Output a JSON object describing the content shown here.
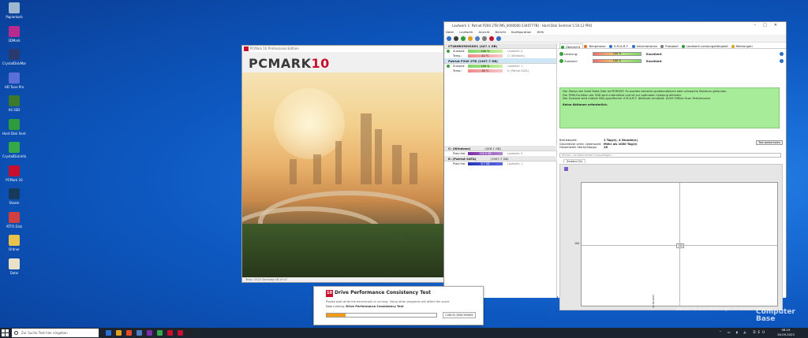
{
  "desktop": {
    "icons": [
      {
        "label": "Papierkorb",
        "color": "#9fb6cf"
      },
      {
        "label": "3DMark",
        "color": "#b82b8c"
      },
      {
        "label": "CrystalDiskMark",
        "color": "#2b3a6e"
      },
      {
        "label": "HD Tune Pro",
        "color": "#5a6fd8"
      },
      {
        "label": "AS SSD",
        "color": "#3a7a2a"
      },
      {
        "label": "Hard Disk Sentinel",
        "color": "#2d9c3c"
      },
      {
        "label": "CrystalDiskInfo",
        "color": "#35a84a"
      },
      {
        "label": "PCMark 10",
        "color": "#c8102e"
      },
      {
        "label": "Steam",
        "color": "#163a5c"
      },
      {
        "label": "ATTO Disk",
        "color": "#d33f3f"
      },
      {
        "label": "Ordner",
        "color": "#e8c24a"
      },
      {
        "label": "Datei",
        "color": "#e9e2c8"
      }
    ]
  },
  "pcmark": {
    "window_title": "PCMark 10 Professional Edition",
    "brand_main": "PCMARK",
    "brand_num": "10",
    "status": "Tests: 2025 Samstag 08:19:47"
  },
  "hds": {
    "window_title": "Laufwerk 1: Patriot P200 2TB [MS_0000000 2340777B] - Hard Disk Sentinel 5.50.12 PRO",
    "menu": [
      "Datei",
      "Laufwerk",
      "Ansicht",
      "Bericht",
      "Konfiguration",
      "Hilfe"
    ],
    "disks": [
      {
        "name": "CT480BX500SSD1 (447.1 GB)",
        "selected": false,
        "rows": [
          {
            "label": "Zustand:",
            "value": "100 %",
            "type": "health",
            "note": "Laufwerk: 0"
          },
          {
            "label": "Temp.:",
            "value": "42 °C",
            "type": "temp",
            "note": "C: [Windows]"
          }
        ]
      },
      {
        "name": "Patriot P200 2TB (1907.7 GB)",
        "selected": true,
        "rows": [
          {
            "label": "Zustand:",
            "value": "100 %",
            "type": "health",
            "note": "Laufwerk: 1"
          },
          {
            "label": "Temp.:",
            "value": "38 °C",
            "type": "temp",
            "note": "E: [Patriot SATA]"
          }
        ]
      }
    ],
    "partitions": [
      {
        "name": "C: (Windows)",
        "size": "(446.1 GB)",
        "free_label": "Platz frei:",
        "free": "346.8 GB",
        "bar": "purple",
        "note": "Laufwerk: 0"
      },
      {
        "name": "E: (Patriot SATA)",
        "size": "(1907.7 GB)",
        "free_label": "Platz frei:",
        "free": "8.7 GB",
        "bar": "blue",
        "note": "Laufwerk: 1"
      }
    ],
    "tabs": [
      "Übersicht",
      "Temperatur",
      "S.M.A.R.T.",
      "Informationen",
      "Protokoll",
      "Laufwerk Leistungsfähigkeit",
      "Meldungen"
    ],
    "health": [
      {
        "label": "Leistung:",
        "value": "100 %",
        "rating": "Excellent"
      },
      {
        "label": "Zustand:",
        "value": "100 %",
        "rating": "Excellent"
      }
    ],
    "status_lines": [
      "Der Status der Solid State Disk ist PERFEKT. Es wurden keinerlei problematische oder schwache Sektoren gefunden.",
      "Die TRIM-Funktion der SSD wird unterstützt und ist zur optimalen Leistung aktiviert.",
      "Der Zustand wird mittels SSD-spezifischer S.M.A.R.T. Attribute ermittelt: #209 Offline Scan Performance"
    ],
    "status_bold": "Keine Aktionen erforderlich.",
    "info": [
      {
        "key": "Betriebszeit:",
        "value": "1 Tag(e), 4 Stunde(n)"
      },
      {
        "key": "Geschätzte verbl. Lebenszeit:",
        "value": "Mehr als 1000 Tag(e)"
      },
      {
        "key": "Gesamtzahl Starts/Stopps:",
        "value": "18"
      }
    ],
    "test_button": "Test wiederholen",
    "notes_placeholder": "Klicken, um Kommentar hinzuzufügen ...",
    "chart_tab": "Zustand (%)",
    "chart": {
      "y_tick": "100",
      "value_label": "100",
      "x_tick": "26.09.2025"
    }
  },
  "dpc": {
    "title": "Drive Performance Consistency Test",
    "message": "Please wait while the benchmark is running. Using other programs will affect the score.",
    "running_prefix": "Now running:",
    "running_name": "Drive Performance Consistency Test",
    "progress": 0.17,
    "cancel": "CANCEL BENCHMARK"
  },
  "watermark": {
    "line1": "Windows aktivieren",
    "line2": "Wechseln Sie zu den Einstellungen, um Windows zu aktivieren."
  },
  "cb_logo": "Computer\nBase",
  "taskbar": {
    "search_placeholder": "Zur Suche Text hier eingeben",
    "time": "08:19",
    "date": "26.09.2025",
    "app_colors": [
      "#2b6fd8",
      "#e0a020",
      "#e24a2a",
      "#4c7cc4",
      "#7a2ea8",
      "#35a84a",
      "#c8102e",
      "#c8102e",
      "#222"
    ]
  }
}
